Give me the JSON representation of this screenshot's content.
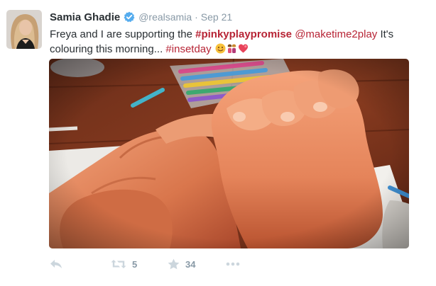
{
  "tweet": {
    "author": {
      "fullname": "Samia Ghadie",
      "screenname": "@realsamia",
      "avatar_icon": "profile-photo"
    },
    "time_separator": "·",
    "timestamp": "Sep 21",
    "text": {
      "part1": "Freya and I are supporting the ",
      "hashtag1": "#pinkyplaypromise",
      "part2": " ",
      "mention1": "@maketime2play",
      "part3": " It's colouring this morning... ",
      "hashtag2": "#insetday",
      "emojis": [
        "smiling-face-emoji",
        "mother-daughter-emoji",
        "heart-emoji"
      ]
    },
    "media": {
      "description_icon": "pinky-promise-photo"
    },
    "actions": {
      "reply_icon": "reply-icon",
      "retweet_icon": "retweet-icon",
      "retweet_count": "5",
      "favorite_icon": "star-icon",
      "favorite_count": "34",
      "more_icon": "more-icon"
    },
    "colors": {
      "accent": "#b72435",
      "name": "#292f33",
      "meta": "#8899a6",
      "action": "#ccd6dd",
      "verified": "#55acee"
    }
  }
}
